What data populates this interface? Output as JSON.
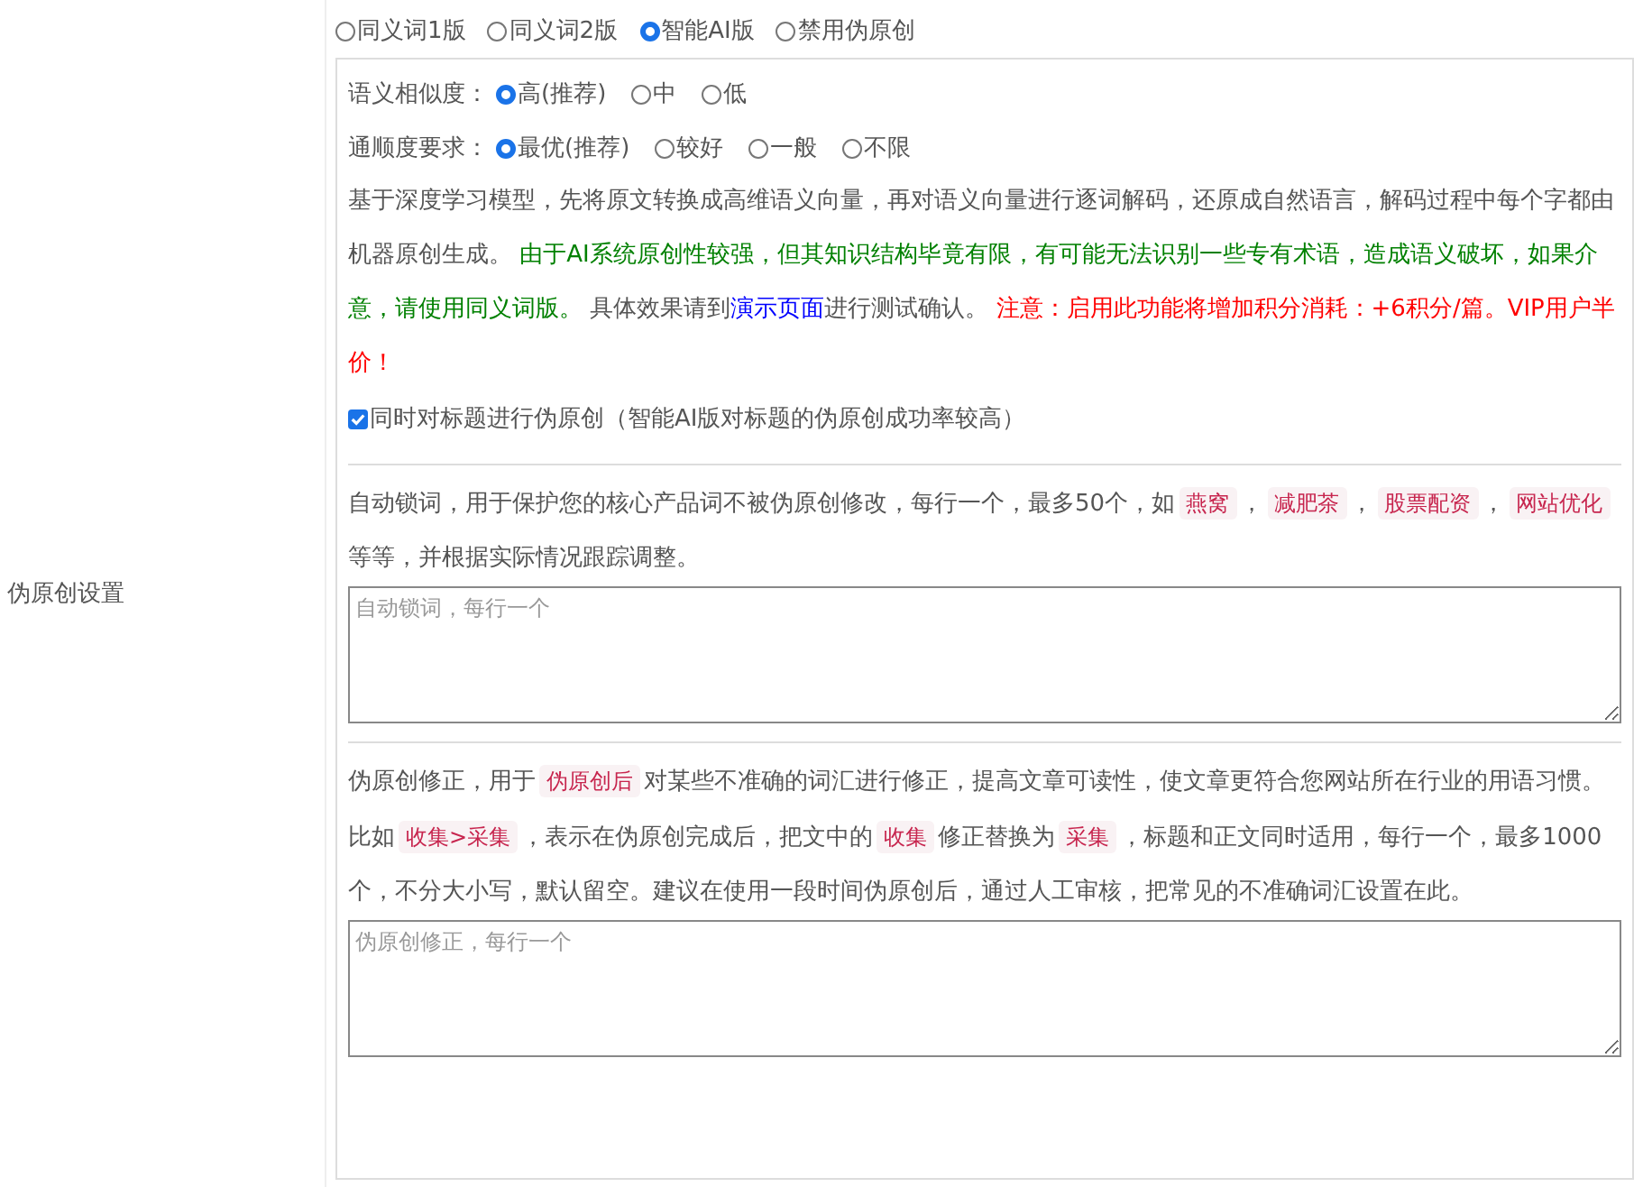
{
  "section_label": "伪原创设置",
  "modes": [
    {
      "label": "同义词1版",
      "selected": false
    },
    {
      "label": "同义词2版",
      "selected": false
    },
    {
      "label": "智能AI版",
      "selected": true
    },
    {
      "label": "禁用伪原创",
      "selected": false
    }
  ],
  "similarity": {
    "label": "语义相似度：",
    "options": [
      {
        "label": "高(推荐)",
        "selected": true
      },
      {
        "label": "中",
        "selected": false
      },
      {
        "label": "低",
        "selected": false
      }
    ]
  },
  "fluency": {
    "label": "通顺度要求：",
    "options": [
      {
        "label": "最优(推荐)",
        "selected": true
      },
      {
        "label": "较好",
        "selected": false
      },
      {
        "label": "一般",
        "selected": false
      },
      {
        "label": "不限",
        "selected": false
      }
    ]
  },
  "ai_description": [
    {
      "kind": "plain",
      "text": "基于深度学习模型，先将原文转换成高维语义向量，再对语义向量进行逐词解码，还原成自然语言，解码过程中每个字都由机器原创生成。 "
    },
    {
      "kind": "green",
      "text": "由于AI系统原创性较强，但其知识结构毕竟有限，有可能无法识别一些专有术语，造成语义破坏，如果介意，请使用同义词版。"
    },
    {
      "kind": "plain",
      "text": " 具体效果请到"
    },
    {
      "kind": "link",
      "text": "演示页面"
    },
    {
      "kind": "plain",
      "text": "进行测试确认。 "
    },
    {
      "kind": "red",
      "text": "注意：启用此功能将增加积分消耗：+6积分/篇。VIP用户半价！"
    }
  ],
  "title_option": {
    "label": "同时对标题进行伪原创（智能AI版对标题的伪原创成功率较高）",
    "checked": true
  },
  "lock_words": {
    "description": [
      {
        "kind": "plain",
        "text": "自动锁词，用于保护您的核心产品词不被伪原创修改，每行一个，最多50个，如"
      },
      {
        "kind": "code",
        "text": "燕窝"
      },
      {
        "kind": "plain",
        "text": "，"
      },
      {
        "kind": "code",
        "text": "减肥茶"
      },
      {
        "kind": "plain",
        "text": "，"
      },
      {
        "kind": "code",
        "text": "股票配资"
      },
      {
        "kind": "plain",
        "text": "，"
      },
      {
        "kind": "code",
        "text": "网站优化"
      },
      {
        "kind": "plain",
        "text": " 等等，并根据实际情况跟踪调整。"
      }
    ],
    "placeholder": "自动锁词，每行一个"
  },
  "corrections": {
    "description": [
      {
        "kind": "plain",
        "text": "伪原创修正，用于"
      },
      {
        "kind": "code",
        "text": "伪原创后"
      },
      {
        "kind": "plain",
        "text": "对某些不准确的词汇进行修正，提高文章可读性，使文章更符合您网站所在行业的用语习惯。比如"
      },
      {
        "kind": "code",
        "text": "收集>采集"
      },
      {
        "kind": "plain",
        "text": "，表示在伪原创完成后，把文中的"
      },
      {
        "kind": "code",
        "text": "收集"
      },
      {
        "kind": "plain",
        "text": "修正替换为"
      },
      {
        "kind": "code",
        "text": "采集"
      },
      {
        "kind": "plain",
        "text": "，标题和正文同时适用，每行一个，最多1000个，不分大小写，默认留空。建议在使用一段时间伪原创后，通过人工审核，把常见的不准确词汇设置在此。"
      }
    ],
    "placeholder": "伪原创修正，每行一个"
  }
}
